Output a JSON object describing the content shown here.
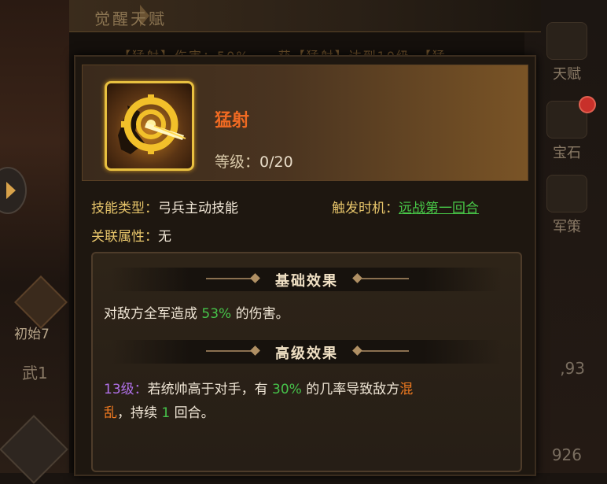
{
  "background": {
    "header_title": "觉醒天赋",
    "strip_text": "【猛射】伤害：50%　　获【猛射】达到10级　【猛",
    "left_label": "初始7",
    "left_wu": "武1",
    "right_buttons": [
      "天赋",
      "宝石",
      "军策"
    ],
    "right_num_1": ",93",
    "right_num_2": "926"
  },
  "skill": {
    "name": "猛射",
    "level_label": "等级：",
    "level_value": "0/20"
  },
  "info": {
    "type_key": "技能类型：",
    "type_value": "弓兵主动技能",
    "trigger_key": "触发时机：",
    "trigger_value": "远战第一回合",
    "attr_key": "关联属性：",
    "attr_value": "无"
  },
  "basic": {
    "title": "基础效果",
    "text_pre": "对敌方全军造成 ",
    "percent": "53%",
    "text_post": " 的伤害。"
  },
  "advanced": {
    "title": "高级效果",
    "level_tag": "13级：",
    "text_1": "若统帅高于对手，有 ",
    "percent": "30%",
    "text_2": " 的几率导致敌方",
    "status_a": "混",
    "status_b": "乱",
    "text_3": "，持续 ",
    "turns": "1",
    "text_4": " 回合。"
  },
  "colors": {
    "skill_name": "#f06a22",
    "info_key": "#e6c46a",
    "highlight_green": "#46c24a",
    "level_purple": "#b070e8",
    "status_orange": "#f07a20",
    "icon_frame_gold": "#e8c040"
  }
}
